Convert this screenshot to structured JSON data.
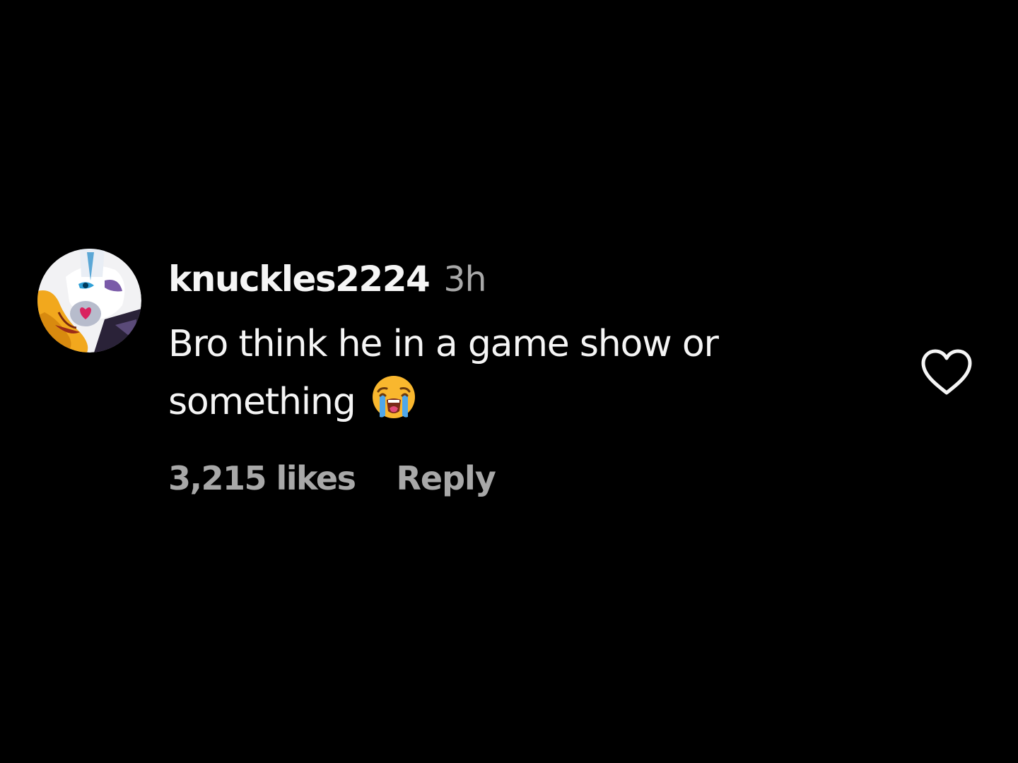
{
  "comment": {
    "username": "knuckles2224",
    "timestamp": "3h",
    "text": "Bro think he in a game show or something",
    "emoji_icon": "loudly-crying-face-icon",
    "likes": "3,215 likes",
    "reply_label": "Reply",
    "like_icon": "heart-outline-icon",
    "avatar_icon": "cartoon-bat-avatar"
  },
  "colors": {
    "background": "#000000",
    "primary_text": "#f5f5f5",
    "secondary_text": "#a8a8a8"
  }
}
